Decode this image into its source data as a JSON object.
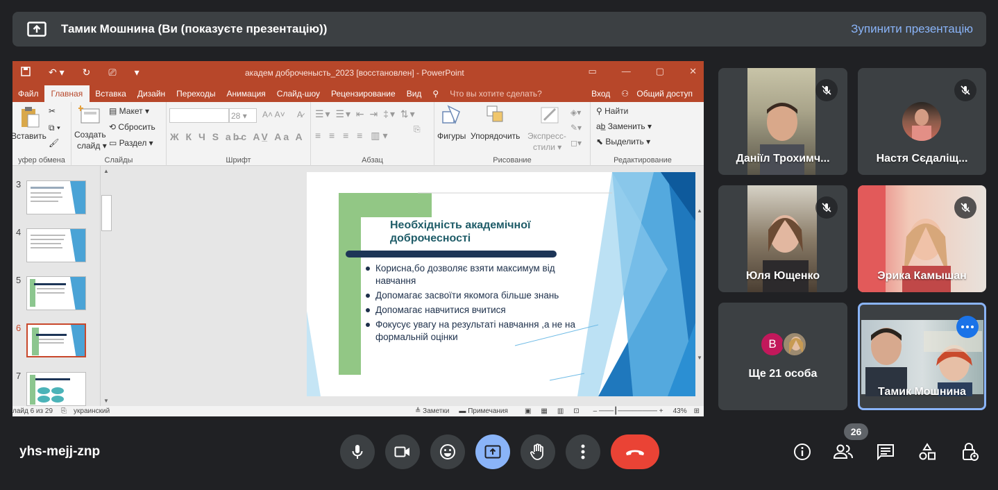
{
  "top_bar": {
    "presenter_title": "Тамик Мошнина (Ви (показуєте презентацію))",
    "stop_label": "Зупинити презентацію"
  },
  "ppt": {
    "window_title": "академ доброченысть_2023 [восстановлен] - PowerPoint",
    "tabs": [
      "Файл",
      "Главная",
      "Вставка",
      "Дизайн",
      "Переходы",
      "Анимация",
      "Слайд-шоу",
      "Рецензирование",
      "Вид"
    ],
    "active_tab": "Главная",
    "tell_me": "Что вы хотите сделать?",
    "signin": "Вход",
    "share": "Общий доступ",
    "ribbon": {
      "paste": "Вставить",
      "clipboard_group": "уфер обмена",
      "new_slide": "Создать",
      "new_slide2": "слайд",
      "layout": "Макет",
      "reset": "Сбросить",
      "section": "Раздел",
      "slides_group": "Слайды",
      "font_size": "28",
      "font_group": "Шрифт",
      "paragraph_group": "Абзац",
      "shapes": "Фигуры",
      "arrange": "Упорядочить",
      "quick_styles": "Экспресс-",
      "quick_styles2": "стили",
      "drawing_group": "Рисование",
      "find": "Найти",
      "replace": "Заменить",
      "select": "Выделить",
      "editing_group": "Редактирование"
    },
    "thumbnails": [
      "3",
      "4",
      "5",
      "6",
      "7"
    ],
    "selected_thumbnail": "6",
    "slide": {
      "title": "Необхідність академічної доброчесності",
      "bullets": [
        "Корисна,бо дозволяє взяти максимум від навчання",
        "Допомагає засвоїти якомога більше знань",
        "Допомагає навчитися вчитися",
        "Фокусує увагу на результаті навчання ,а не на формальній оцінки"
      ]
    },
    "status": {
      "slide_count": "лайд 6 из 29",
      "language": "украинский",
      "notes": "Заметки",
      "comments": "Примечания",
      "zoom": "43%"
    }
  },
  "participants": [
    {
      "name": "Даніїл Трохимч...",
      "muted": true
    },
    {
      "name": "Настя Сєдаліщ...",
      "muted": true
    },
    {
      "name": "Юля Ющенко",
      "muted": true
    },
    {
      "name": "Эрика Камышан",
      "muted": true
    },
    {
      "name": "Ще 21 особа",
      "avatar_letter": "B"
    },
    {
      "name": "Тамик Мошнина",
      "active": true
    }
  ],
  "bottom_bar": {
    "meeting_code": "yhs-mejj-znp",
    "participant_count": "26"
  },
  "colors": {
    "ppt_accent": "#b7472a",
    "present_active": "#8ab4f8",
    "end_call": "#ea4335",
    "slide_title": "#1f5c68"
  }
}
